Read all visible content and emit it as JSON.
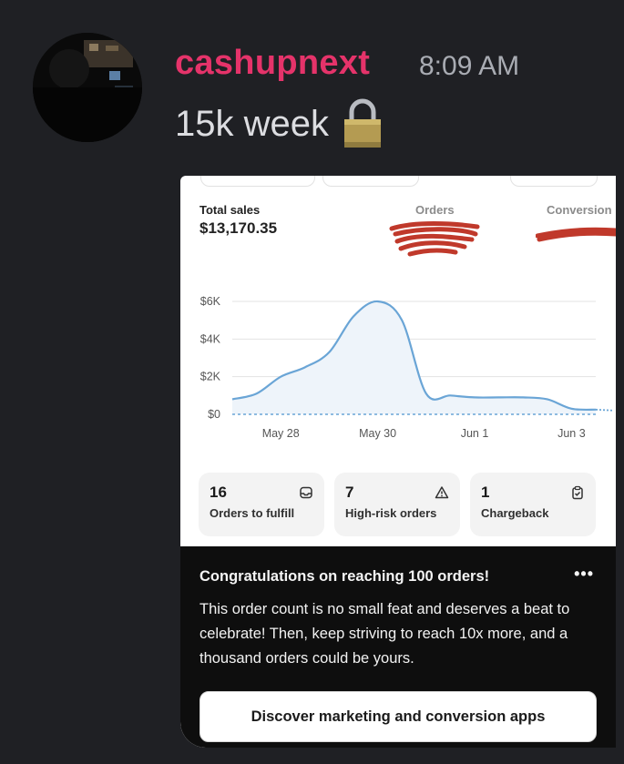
{
  "message": {
    "username": "cashupnext",
    "timestamp": "8:09 AM",
    "text": "15k week",
    "emoji_icon": "lock-icon"
  },
  "dashboard": {
    "total_sales_label": "Total sales",
    "total_sales_value": "$13,170.35",
    "orders_label": "Orders",
    "conversion_label": "Conversion",
    "stats": [
      {
        "value": "16",
        "label": "Orders to fulfill",
        "icon": "inbox-icon"
      },
      {
        "value": "7",
        "label": "High-risk orders",
        "icon": "warning-icon"
      },
      {
        "value": "1",
        "label": "Chargeback",
        "icon": "clipboard-check-icon"
      }
    ],
    "banner": {
      "title": "Congratulations on reaching 100 orders!",
      "more": "•••",
      "body": "This order count is no small feat and deserves a beat to celebrate! Then, keep striving to reach 10x more, and a thousand orders could be yours.",
      "button": "Discover marketing and conversion apps"
    }
  },
  "chart_data": {
    "type": "line",
    "categories": [
      "May 28",
      "May 30",
      "Jun 1",
      "Jun 3"
    ],
    "y_tick_labels": [
      "$0",
      "$2K",
      "$4K",
      "$6K"
    ],
    "ylim": [
      0,
      6000
    ],
    "grid": true,
    "series": [
      {
        "color": "#6aa5d6",
        "x": [
          27.0,
          27.5,
          28.0,
          28.5,
          29.0,
          29.5,
          30.0,
          30.5,
          31.0,
          31.5,
          32.0,
          32.5,
          33.0,
          33.5,
          34.0,
          34.5
        ],
        "values": [
          800,
          1100,
          2000,
          2500,
          3300,
          5200,
          6000,
          5000,
          1100,
          1000,
          900,
          900,
          900,
          800,
          300,
          250
        ]
      },
      {
        "color": "#6aa5d6",
        "dashed": true,
        "x": [
          27.0,
          34.5
        ],
        "values": [
          0,
          0
        ]
      }
    ]
  }
}
